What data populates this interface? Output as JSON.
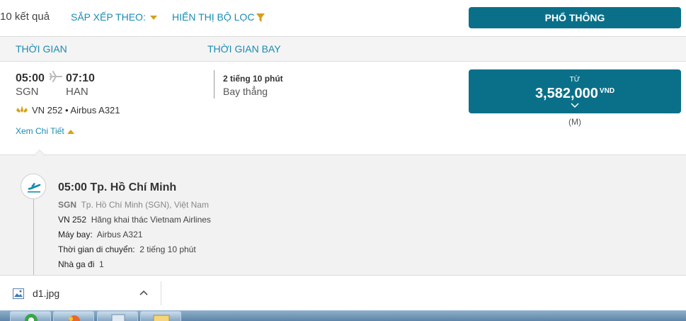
{
  "toolbar": {
    "results_count": "10 kết quả",
    "sort_label": "SẮP XẾP THEO:",
    "filter_label": "HIỂN THỊ BỘ LỌC",
    "cabin_label": "PHỔ THÔNG"
  },
  "columns": {
    "time": "THỜI GIAN",
    "flight_time": "THỜI GIAN BAY"
  },
  "flight": {
    "dep_time": "05:00",
    "arr_time": "07:10",
    "dep_code": "SGN",
    "arr_code": "HAN",
    "flight_info": "VN 252 • Airbus A321",
    "detail_link": "Xem Chi Tiết",
    "duration": "2 tiếng 10 phút",
    "nonstop": "Bay thẳng",
    "price_from": "TỪ",
    "price_amount": "3,582,000",
    "price_currency": "VND",
    "fare_class": "(M)"
  },
  "segment": {
    "title": "05:00  Tp. Hồ Chí Minh",
    "airport_code": "SGN",
    "airport_name": "Tp. Hồ Chí Minh (SGN), Việt Nam",
    "flight_no": "VN 252",
    "operator": "Hãng khai thác Vietnam Airlines",
    "aircraft_label": "Máy bay:",
    "aircraft": "Airbus A321",
    "travel_time_label": "Thời gian di chuyển:",
    "travel_time": "2 tiếng 10 phút",
    "terminal_label": "Nhà ga đi",
    "terminal": "1"
  },
  "download": {
    "file_name": "d1.jpg"
  },
  "colors": {
    "accent": "#0a7089",
    "link": "#1a8bb3",
    "gold": "#d4a017"
  }
}
